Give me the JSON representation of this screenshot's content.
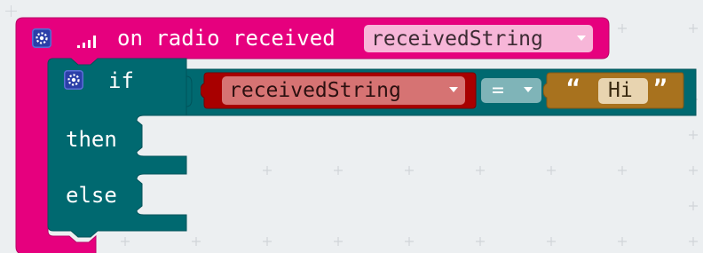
{
  "event_block": {
    "label": "on radio received",
    "variable": "receivedString",
    "settings_icon": "gear-icon",
    "signal_icon": "signal-strength-icon",
    "color": "#e6007e"
  },
  "if_block": {
    "if_label": "if",
    "then_label": "then",
    "else_label": "else",
    "settings_icon": "gear-icon",
    "color": "#006970"
  },
  "condition": {
    "variable": "receivedString",
    "operator": "=",
    "string_open_quote": "“",
    "string_value": "Hi",
    "string_close_quote": "”",
    "variable_color": "#a80000",
    "compare_color": "#006970",
    "string_color": "#a8721e"
  },
  "dropdown_icon": "dropdown-caret-icon"
}
